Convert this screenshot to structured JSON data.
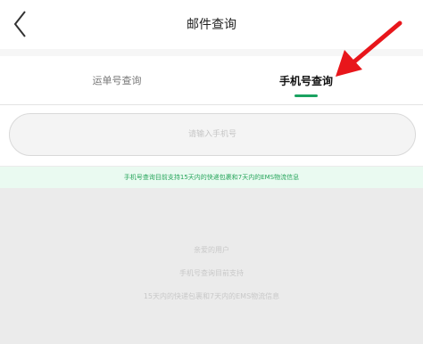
{
  "header": {
    "title": "邮件查询"
  },
  "tabs": [
    {
      "label": "运单号查询",
      "active": false
    },
    {
      "label": "手机号查询",
      "active": true
    }
  ],
  "search": {
    "placeholder": "请输入手机号",
    "value": ""
  },
  "notice": "手机号查询目前支持15天内的快递包裹和7天内的EMS物流信息",
  "empty_state": {
    "line1": "亲爱的用户",
    "line2": "手机号查询目前支持",
    "line3": "15天内的快递包裹和7天内的EMS物流信息"
  },
  "colors": {
    "accent": "#1aa260",
    "annotation_arrow": "#e8161b",
    "notice_bg": "#eafaf1",
    "page_bg": "#ebebeb"
  }
}
